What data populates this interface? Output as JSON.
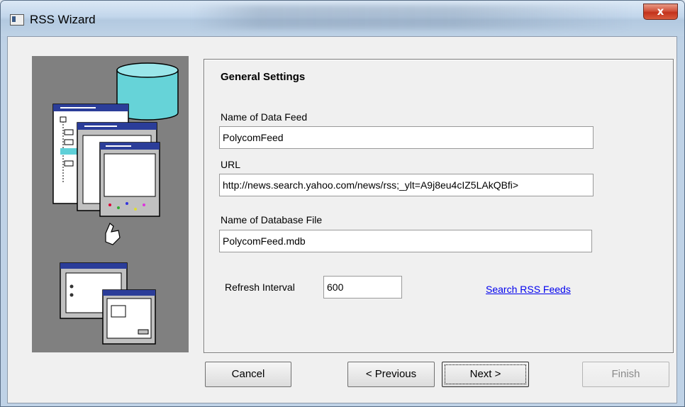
{
  "window": {
    "title": "RSS Wizard",
    "close_glyph": "x"
  },
  "section": {
    "heading": "General Settings"
  },
  "fields": {
    "feed_name": {
      "label": "Name of Data Feed",
      "value": "PolycomFeed"
    },
    "url": {
      "label": "URL",
      "value": "http://news.search.yahoo.com/news/rss;_ylt=A9j8eu4cIZ5LAkQBfi>"
    },
    "db_file": {
      "label": "Name of Database File",
      "value": "PolycomFeed.mdb"
    },
    "refresh": {
      "label": "Refresh Interval",
      "value": "600"
    }
  },
  "link": {
    "search_feeds": "Search RSS Feeds"
  },
  "buttons": {
    "cancel": "Cancel",
    "previous": "< Previous",
    "next": "Next >",
    "finish": "Finish"
  },
  "icons": {
    "app": "window-icon",
    "illustration": "wizard-illustration-icon"
  },
  "colors": {
    "link": "#0000ee",
    "close_button": "#c3321c",
    "art_background": "#808080"
  }
}
